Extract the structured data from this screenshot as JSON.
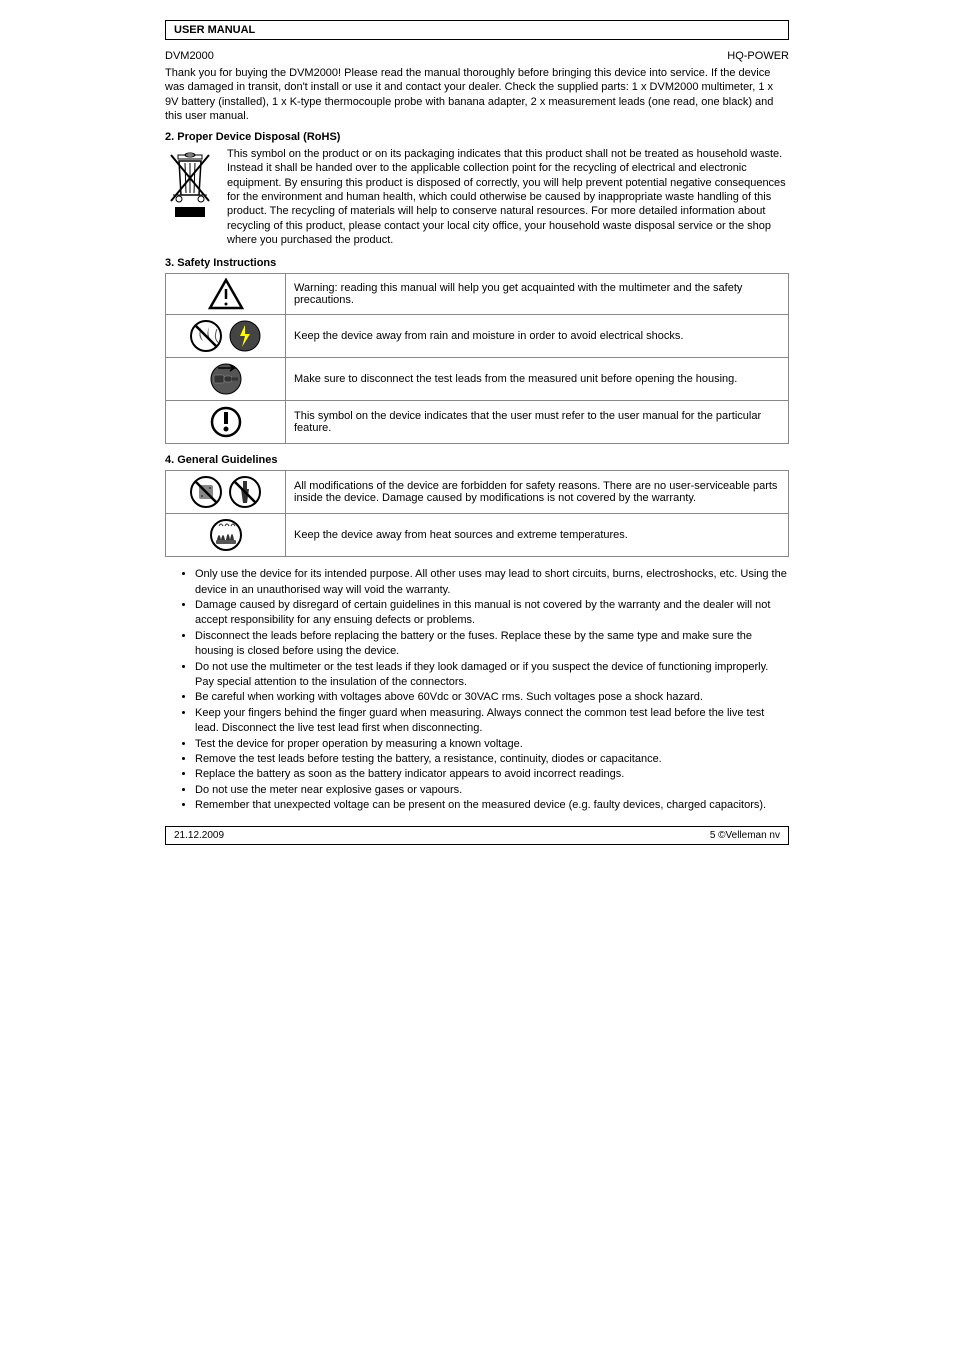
{
  "topBar": "USER MANUAL",
  "productCode": {
    "left": "DVM2000",
    "right": "HQ-POWER"
  },
  "intro": "Thank you for buying the DVM2000! Please read the manual thoroughly before bringing this device into service. If the device was damaged in transit, don't install or use it and contact your dealer. Check the supplied parts: 1 x DVM2000 multimeter, 1 x 9V battery (installed), 1 x K-type thermocouple probe with banana adapter, 2 x measurement leads (one read, one black) and this user manual.",
  "sections": {
    "disposal": {
      "heading": "2. Proper Device Disposal (RoHS)",
      "text": "This symbol on the product or on its packaging indicates that this product shall not be treated as household waste. Instead it shall be handed over to the applicable collection point for the recycling of electrical and electronic equipment. By ensuring this product is disposed of correctly, you will help prevent potential negative consequences for the environment and human health, which could otherwise be caused by inappropriate waste handling of this product. The recycling of materials will help to conserve natural resources. For more detailed information about recycling of this product, please contact your local city office, your household waste disposal service or the shop where you purchased the product."
    },
    "safety": {
      "heading": "3. Safety Instructions",
      "table1": [
        {
          "iconName": "warning-triangle-icon",
          "text": "Warning: reading this manual will help you get acquainted with the multimeter and the safety precautions."
        },
        {
          "iconName": "no-water-shock-icon",
          "text": "Keep the device away from rain and moisture in order to avoid electrical shocks."
        },
        {
          "iconName": "unplug-icon",
          "text": "Make sure to disconnect the test leads from the measured unit before opening the housing."
        },
        {
          "iconName": "caution-circle-icon",
          "text": "This symbol on the device indicates that the user must refer to the user manual for the particular feature."
        }
      ]
    },
    "guidelines": {
      "heading": "4. General Guidelines",
      "table2": [
        {
          "iconName": "no-disassemble-icon",
          "text": "All modifications of the device are forbidden for safety reasons. There are no user-serviceable parts inside the device. Damage caused by modifications is not covered by the warranty."
        },
        {
          "iconName": "hot-surface-icon",
          "text": "Keep the device away from heat sources and extreme temperatures."
        }
      ],
      "bullets": [
        "Only use the device for its intended purpose. All other uses may lead to short circuits, burns, electroshocks, etc. Using the device in an unauthorised way will void the warranty.",
        "Damage caused by disregard of certain guidelines in this manual is not covered by the warranty and the dealer will not accept responsibility for any ensuing defects or problems.",
        "Disconnect the leads before replacing the battery or the fuses. Replace these by the same type and make sure the housing is closed before using the device.",
        "Do not use the multimeter or the test leads if they look damaged or if you suspect the device of functioning improperly. Pay special attention to the insulation of the connectors.",
        "Be careful when working with voltages above 60Vdc or 30VAC rms. Such voltages pose a shock hazard.",
        "Keep your fingers behind the finger guard when measuring. Always connect the common test lead before the live test lead. Disconnect the live test lead first when disconnecting.",
        "Test the device for proper operation by measuring a known voltage.",
        "Remove the test leads before testing the battery, a resistance, continuity, diodes or capacitance.",
        "Replace the battery as soon as the battery indicator appears to avoid incorrect readings.",
        "Do not use the meter near explosive gases or vapours.",
        "Remember that unexpected voltage can be present on the measured device (e.g. faulty devices, charged capacitors)."
      ]
    }
  },
  "bottomBar": {
    "left": "21.12.2009",
    "right": "5     ©Velleman nv"
  }
}
